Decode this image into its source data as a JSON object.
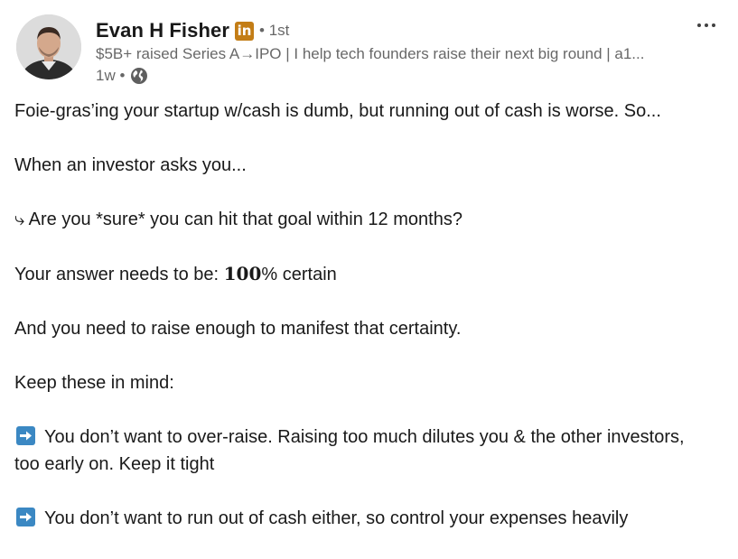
{
  "author": {
    "name": "Evan H Fisher",
    "badge_label": "in",
    "degree": "• 1st",
    "headline": "$5B+ raised Series A→IPO | I help tech founders raise their next big round | a1...",
    "time": "1w •",
    "visibility_icon": "globe-icon"
  },
  "menu": {
    "icon": "more-dots-icon"
  },
  "post": {
    "line1": "Foie-gras’ing your startup w/cash is dumb, but running out of cash is worse. So...",
    "line2": "When an investor asks you...",
    "line3": "⤷ Are you *sure* you can hit that goal within 12 months?",
    "line4_prefix": "Your answer needs to be: ",
    "line4_bold": "100",
    "line4_suffix": "% certain",
    "line5": "And you need to raise enough to manifest that certainty.",
    "line6": "Keep these in mind:",
    "bullet1_line1": "You don’t want to over-raise. Raising too much dilutes you & the other investors,",
    "bullet1_line2": "too early on. Keep it tight",
    "bullet2": "You don’t want to run out of cash either, so control your expenses heavily"
  },
  "colors": {
    "badge": "#c37d16",
    "arrow_emoji": "#3b88c3",
    "secondary_text": "rgba(0,0,0,0.6)"
  }
}
